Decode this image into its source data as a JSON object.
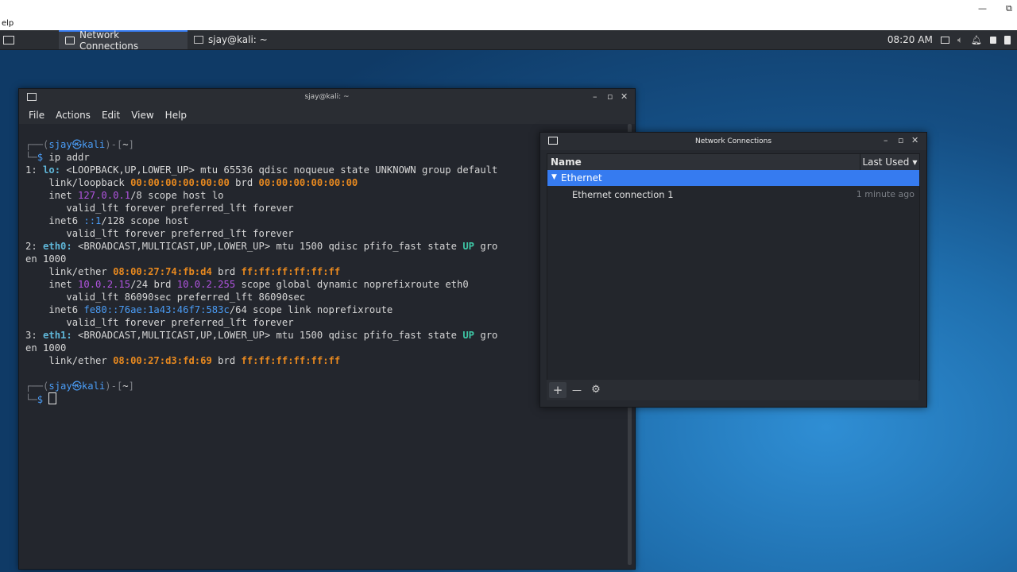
{
  "host": {
    "menu_fragment": "elp",
    "min": "—",
    "restore": "⧉"
  },
  "panel": {
    "tasks": [
      {
        "label": "Network Connections",
        "active": true
      },
      {
        "label": "sjay@kali: ~",
        "active": false
      }
    ],
    "clock": "08:20 AM"
  },
  "terminal": {
    "title": "sjay@kali: ~",
    "menu": [
      "File",
      "Actions",
      "Edit",
      "View",
      "Help"
    ],
    "prompt_user": "sjay",
    "prompt_host": "kali",
    "prompt_dir": "~",
    "command": "ip addr",
    "output": {
      "l1": "1: lo: <LOOPBACK,UP,LOWER_UP> mtu 65536 qdisc noqueue state UNKNOWN group default",
      "lo_link": "00:00:00:00:00:00",
      "lo_brd": "00:00:00:00:00:00",
      "lo_inet": "127.0.0.1",
      "lo_inet6": "::1",
      "eth0_mac": "08:00:27:74:fb:d4",
      "brd_all": "ff:ff:ff:ff:ff:ff",
      "eth0_inet": "10.0.2.15",
      "eth0_brd": "10.0.2.255",
      "eth0_inet6": "fe80::76ae:1a43:46f7:583c",
      "eth1_mac": "08:00:27:d3:fd:69",
      "valid_lo": "valid_lft forever preferred_lft forever",
      "valid_eth0": "valid_lft 86090sec preferred_lft 86090sec"
    }
  },
  "network_connections": {
    "title": "Network Connections",
    "col_name": "Name",
    "col_last_used": "Last Used",
    "group": "Ethernet",
    "rows": [
      {
        "name": "Ethernet connection 1",
        "last_used": "1 minute ago"
      }
    ],
    "toolbar": {
      "add": "+",
      "remove": "—",
      "settings": "⚙"
    }
  },
  "colors": {
    "accent": "#367bf0",
    "terminal_bg": "#23262d",
    "ip_color": "#b154e0",
    "mac_color": "#e8891f",
    "iface_color": "#5fb7d9",
    "up_color": "#3ec8a6"
  }
}
